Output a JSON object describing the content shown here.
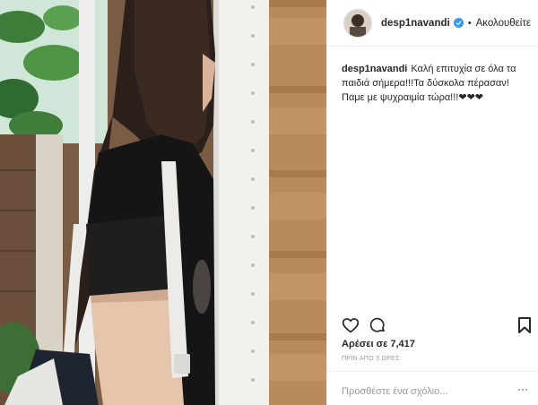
{
  "post": {
    "username": "desp1navandi",
    "follow_label": "Ακολουθείτε",
    "caption": "Καλή επιτυχία σε όλα τα παιδιά σήμερα!!!Τα δύσκολα πέρασαν! Παμε με ψυχραιμία τώρα!!!❤❤❤",
    "likes": "Αρέσει σε 7,417",
    "timestamp": "ΠΡΙΝ ΑΠΟ 3 ΩΡΕΣ",
    "comment_placeholder": "Προσθέστε ένα σχόλιο...",
    "more_label": "···"
  },
  "icons": {
    "verified": "verified-badge-icon",
    "like": "heart-icon",
    "comment": "comment-icon",
    "save": "bookmark-icon",
    "more": "more-options-icon"
  },
  "colors": {
    "verified_blue": "#3897f0",
    "text": "#262626",
    "muted": "#999999",
    "border": "#efefef"
  }
}
